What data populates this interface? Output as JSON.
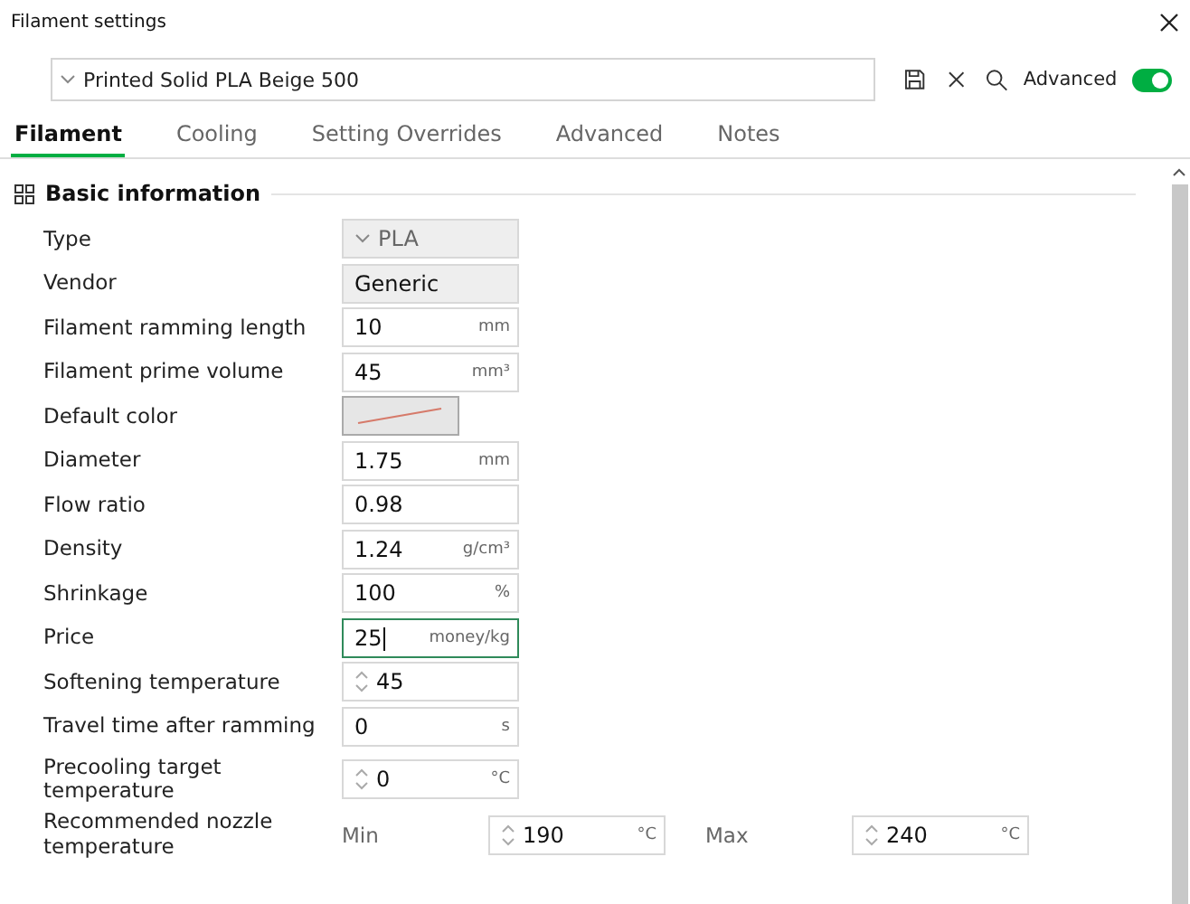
{
  "window": {
    "title": "Filament settings"
  },
  "preset": {
    "value": "Printed Solid PLA Beige 500"
  },
  "advanced": {
    "label": "Advanced",
    "on": true
  },
  "tabs": [
    {
      "label": "Filament",
      "selected": true
    },
    {
      "label": "Cooling",
      "selected": false
    },
    {
      "label": "Setting Overrides",
      "selected": false
    },
    {
      "label": "Advanced",
      "selected": false
    },
    {
      "label": "Notes",
      "selected": false
    }
  ],
  "section": {
    "title": "Basic information"
  },
  "rows": [
    {
      "kind": "dropdown",
      "label": "Type",
      "value": "PLA",
      "disabled": true
    },
    {
      "kind": "readonly",
      "label": "Vendor",
      "value": "Generic"
    },
    {
      "kind": "text",
      "label": "Filament ramming length",
      "value": "10",
      "unit": "mm",
      "focused": false
    },
    {
      "kind": "text",
      "label": "Filament prime volume",
      "value": "45",
      "unit": "mm³",
      "focused": false
    },
    {
      "kind": "color",
      "label": "Default color",
      "color": "#d67a6a"
    },
    {
      "kind": "text",
      "label": "Diameter",
      "value": "1.75",
      "unit": "mm",
      "focused": false
    },
    {
      "kind": "text",
      "label": "Flow ratio",
      "value": "0.98",
      "focused": false
    },
    {
      "kind": "text",
      "label": "Density",
      "value": "1.24",
      "unit": "g/cm³",
      "focused": false
    },
    {
      "kind": "text",
      "label": "Shrinkage",
      "value": "100",
      "unit": "%",
      "focused": false
    },
    {
      "kind": "text",
      "label": "Price",
      "value": "25",
      "unit": "money/kg",
      "focused": true
    },
    {
      "kind": "spin",
      "label": "Softening temperature",
      "value": "45"
    },
    {
      "kind": "text",
      "label": "Travel time after ramming",
      "value": "0",
      "unit": "s",
      "focused": false
    },
    {
      "kind": "spin",
      "label": "Precooling target temperature",
      "value": "0",
      "unit": "°C"
    },
    {
      "kind": "range",
      "label": "Recommended nozzle temperature",
      "min_label": "Min",
      "min": "190",
      "min_unit": "°C",
      "max_label": "Max",
      "max": "240",
      "max_unit": "°C"
    }
  ]
}
